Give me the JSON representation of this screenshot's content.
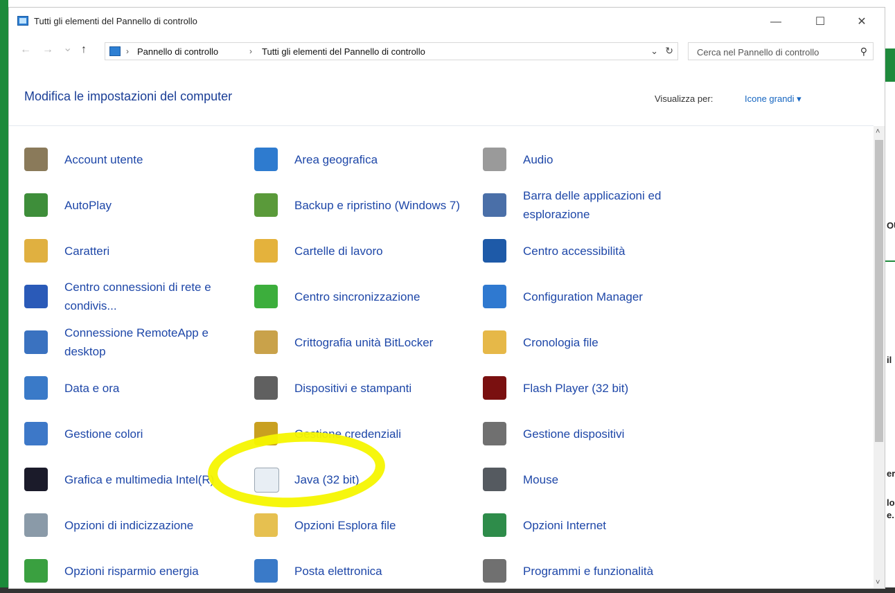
{
  "window": {
    "title": "Tutti gli elementi del Pannello di controllo",
    "controls": {
      "minimize": "—",
      "maximize": "☐",
      "close": "✕"
    }
  },
  "nav": {
    "back": "←",
    "forward": "→",
    "history": "⌄",
    "up": "↑"
  },
  "address": {
    "sep": "›",
    "crumbs": [
      "Pannello di controllo",
      "Tutti gli elementi del Pannello di controllo"
    ],
    "dropdown": "⌄",
    "refresh": "↻"
  },
  "search": {
    "placeholder": "Cerca nel Pannello di controllo",
    "icon": "⚲"
  },
  "header": {
    "page_title": "Modifica le impostazioni del computer",
    "view_label": "Visualizza per:",
    "view_value": "Icone grandi ▾"
  },
  "scrollbar": {
    "up": "˄",
    "down": "˅"
  },
  "items": [
    {
      "name": "Account utente",
      "icon": "users-icon",
      "color": "#8a7a5a"
    },
    {
      "name": "Area geografica",
      "icon": "globe-clock-icon",
      "color": "#2e7bcf"
    },
    {
      "name": "Audio",
      "icon": "speaker-icon",
      "color": "#9a9a9a"
    },
    {
      "name": "AutoPlay",
      "icon": "autoplay-icon",
      "color": "#3e8e3a"
    },
    {
      "name": "Backup e ripristino (Windows 7)",
      "icon": "backup-icon",
      "color": "#5a9a3a"
    },
    {
      "name": "Barra delle applicazioni ed esplorazione",
      "icon": "taskbar-icon",
      "color": "#4a6fa8"
    },
    {
      "name": "Caratteri",
      "icon": "fonts-icon",
      "color": "#e0b040"
    },
    {
      "name": "Cartelle di lavoro",
      "icon": "work-folders-icon",
      "color": "#e4b23c"
    },
    {
      "name": "Centro accessibilità",
      "icon": "accessibility-icon",
      "color": "#1e5aa8"
    },
    {
      "name": "Centro connessioni di rete e condivis...",
      "icon": "network-icon",
      "color": "#2a5ab8"
    },
    {
      "name": "Centro sincronizzazione",
      "icon": "sync-icon",
      "color": "#3cae3c"
    },
    {
      "name": "Configuration Manager",
      "icon": "config-manager-icon",
      "color": "#2f79d0"
    },
    {
      "name": "Connessione RemoteApp e desktop",
      "icon": "remoteapp-icon",
      "color": "#3a72c0"
    },
    {
      "name": "Crittografia unità BitLocker",
      "icon": "bitlocker-icon",
      "color": "#c9a24a"
    },
    {
      "name": "Cronologia file",
      "icon": "file-history-icon",
      "color": "#e6b848"
    },
    {
      "name": "Data e ora",
      "icon": "calendar-clock-icon",
      "color": "#3a7ac8"
    },
    {
      "name": "Dispositivi e stampanti",
      "icon": "printer-icon",
      "color": "#606060"
    },
    {
      "name": "Flash Player (32 bit)",
      "icon": "flash-icon",
      "color": "#7a1010"
    },
    {
      "name": "Gestione colori",
      "icon": "color-management-icon",
      "color": "#3d78c8"
    },
    {
      "name": "Gestione credenziali",
      "icon": "credential-vault-icon",
      "color": "#c9a020"
    },
    {
      "name": "Gestione dispositivi",
      "icon": "device-manager-icon",
      "color": "#707070"
    },
    {
      "name": "Grafica e multimedia Intel(R)",
      "icon": "intel-graphics-icon",
      "color": "#1b1b2a"
    },
    {
      "name": "Java (32 bit)",
      "icon": "java-icon",
      "color": "#e8eef4"
    },
    {
      "name": "Mouse",
      "icon": "mouse-icon",
      "color": "#555a60"
    },
    {
      "name": "Opzioni di indicizzazione",
      "icon": "indexing-icon",
      "color": "#8a9aa8"
    },
    {
      "name": "Opzioni Esplora file",
      "icon": "explorer-options-icon",
      "color": "#e6c050"
    },
    {
      "name": "Opzioni Internet",
      "icon": "internet-options-icon",
      "color": "#2e8c4a"
    },
    {
      "name": "Opzioni risparmio energia",
      "icon": "power-options-icon",
      "color": "#3aa040"
    },
    {
      "name": "Posta elettronica",
      "icon": "mail-icon",
      "color": "#3a7ac8"
    },
    {
      "name": "Programmi e funzionalità",
      "icon": "programs-icon",
      "color": "#707070"
    }
  ],
  "background": {
    "right_labels": [
      "OU",
      "il",
      "er",
      "loz",
      "e.:"
    ]
  }
}
